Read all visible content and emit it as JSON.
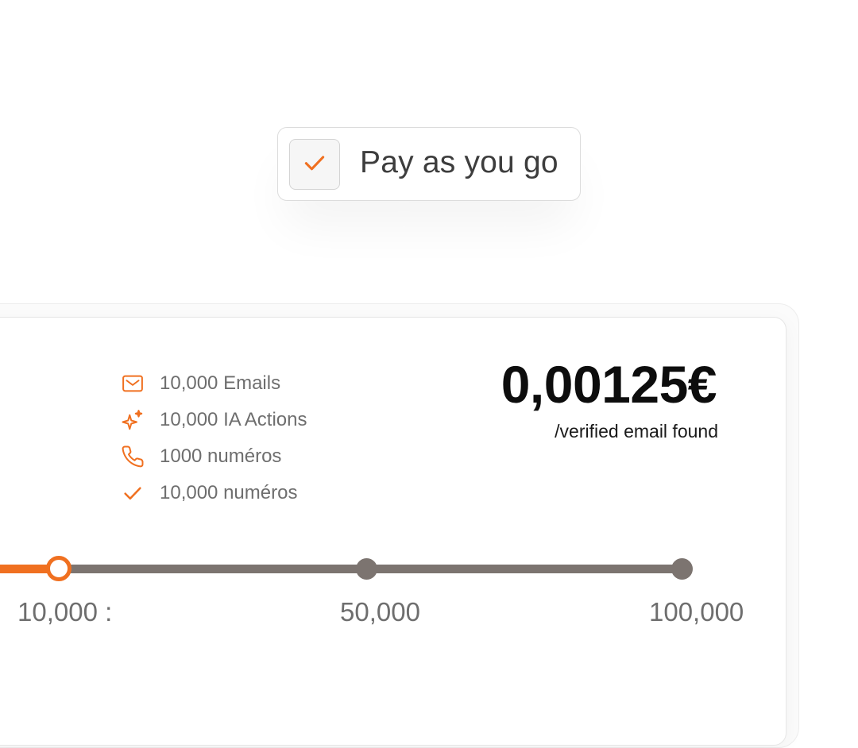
{
  "toggle": {
    "label": "Pay as you go",
    "checked": true,
    "check_icon": "check-icon"
  },
  "plan": {
    "features": [
      {
        "icon": "mail-icon",
        "label": "10,000 Emails"
      },
      {
        "icon": "sparkles-icon",
        "label": "10,000 IA Actions"
      },
      {
        "icon": "phone-icon",
        "label": "1000 numéros"
      },
      {
        "icon": "check-icon",
        "label": "10,000 numéros"
      }
    ],
    "price": "0,00125€",
    "price_unit": "/verified email found"
  },
  "slider": {
    "ticks": [
      "10,000 :",
      "50,000",
      "100,000"
    ],
    "selected_index": 0
  },
  "colors": {
    "accent": "#f07020",
    "track": "#7c7470",
    "text_muted": "#6e6e6e",
    "text_dark": "#0d0d0d"
  }
}
